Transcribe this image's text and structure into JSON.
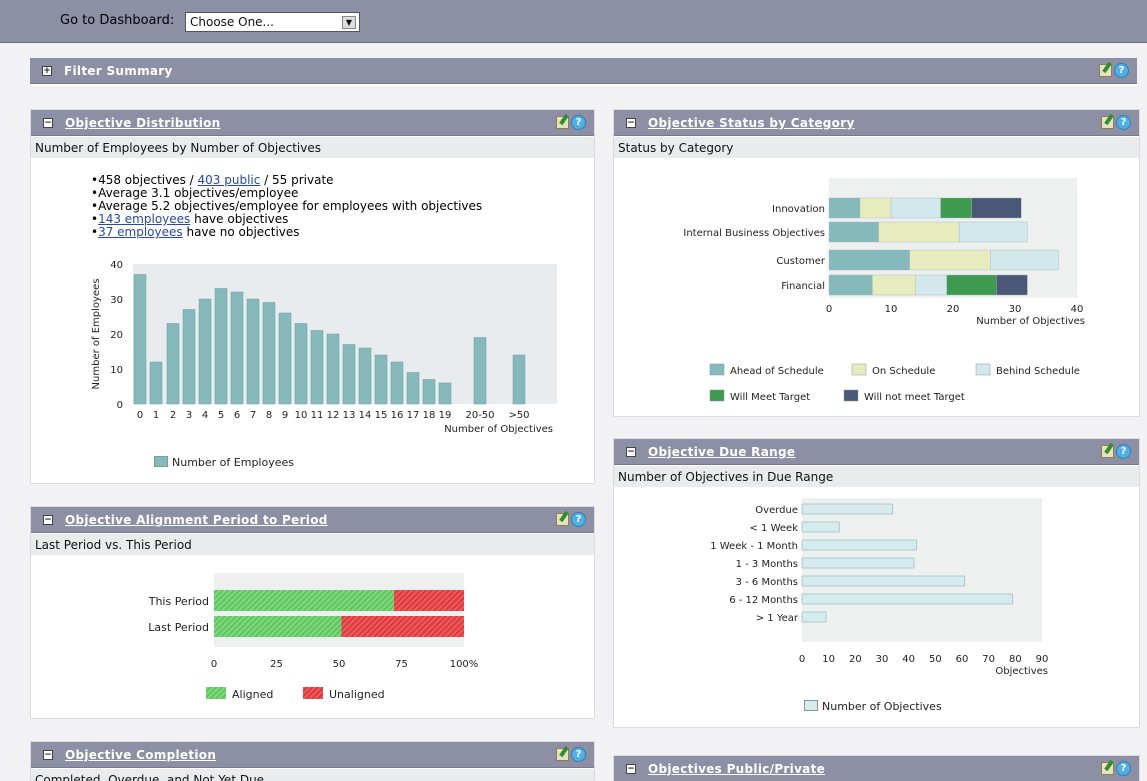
{
  "topbar": {
    "label": "Go to Dashboard:",
    "select_value": "Choose One..."
  },
  "filter": {
    "title": "Filter Summary",
    "toggle": "+"
  },
  "distribution": {
    "title": "Objective Distribution",
    "subtitle": "Number of Employees by Number of Objectives",
    "b1_pre": "•458 objectives / ",
    "b1_link": "403 public",
    "b1_post": " / 55 private",
    "b2": "•Average 3.1 objectives/employee",
    "b3": "•Average 5.2 objectives/employee for employees with objectives",
    "b4_link": "143 employees",
    "b4_post": " have objectives",
    "b5_link": "37 employees",
    "b5_post": " have no objectives",
    "legend": "Number of Employees"
  },
  "status": {
    "title": "Objective Status by Category",
    "subtitle": "Status by Category"
  },
  "due": {
    "title": "Objective Due Range",
    "subtitle": "Number of Objectives in Due Range",
    "legend": "Number of Objectives"
  },
  "alignment": {
    "title": "Objective Alignment Period to Period",
    "subtitle": "Last Period vs. This Period"
  },
  "completion": {
    "title": "Objective Completion",
    "subtitle": "Completed, Overdue, and Not Yet Due"
  },
  "public_private": {
    "title": "Objectives Public/Private"
  },
  "colors": {
    "aligned": "#5cc65c",
    "unaligned": "#e0393b",
    "teal": "#86b9bb"
  },
  "chart_data": [
    {
      "type": "bar",
      "title": "",
      "xlabel": "Number of Objectives",
      "ylabel": "Number of Employees",
      "ylim": [
        0,
        40
      ],
      "yticks": [
        0,
        10,
        20,
        30,
        40
      ],
      "categories": [
        "0",
        "1",
        "2",
        "3",
        "4",
        "5",
        "6",
        "7",
        "8",
        "9",
        "10",
        "11",
        "12",
        "13",
        "14",
        "15",
        "16",
        "17",
        "18",
        "19",
        "20-50",
        ">50"
      ],
      "series": [
        {
          "name": "Number of Employees",
          "values": [
            37,
            12,
            23,
            27,
            30,
            33,
            32,
            30,
            29,
            26,
            23,
            21,
            20,
            17,
            16,
            14,
            12,
            9,
            7,
            6,
            19,
            14
          ]
        }
      ]
    },
    {
      "type": "bar",
      "orientation": "horizontal",
      "stacked": true,
      "xlabel": "Number of Objectives",
      "xlim": [
        0,
        40
      ],
      "xticks": [
        0,
        10,
        20,
        30,
        40
      ],
      "categories": [
        "Innovation",
        "Internal Business Objectives",
        "Customer",
        "Financial"
      ],
      "series": [
        {
          "name": "Ahead of Schedule",
          "color": "#86b9bb",
          "values": [
            5,
            8,
            13,
            7
          ]
        },
        {
          "name": "On Schedule",
          "color": "#e7ecbe",
          "values": [
            5,
            13,
            13,
            7
          ]
        },
        {
          "name": "Behind Schedule",
          "color": "#d3e8ec",
          "values": [
            8,
            11,
            11,
            5
          ]
        },
        {
          "name": "Will Meet Target",
          "color": "#3e9a4e",
          "values": [
            5,
            0,
            0,
            8
          ]
        },
        {
          "name": "Will not meet Target",
          "color": "#4a5877",
          "values": [
            8,
            0,
            0,
            5
          ]
        }
      ]
    },
    {
      "type": "bar",
      "orientation": "horizontal",
      "xlabel": "Objectives",
      "xlim": [
        0,
        90
      ],
      "xticks": [
        0,
        10,
        20,
        30,
        40,
        50,
        60,
        70,
        80,
        90
      ],
      "categories": [
        "Overdue",
        "< 1 Week",
        "1 Week - 1 Month",
        "1 - 3 Months",
        "3 - 6 Months",
        "6 - 12 Months",
        "> 1 Year"
      ],
      "series": [
        {
          "name": "Number of Objectives",
          "values": [
            34,
            14,
            43,
            42,
            61,
            79,
            9
          ]
        }
      ]
    },
    {
      "type": "bar",
      "orientation": "horizontal",
      "stacked": true,
      "xlim": [
        0,
        100
      ],
      "xtick_labels": [
        "0",
        "25",
        "50",
        "75",
        "100%"
      ],
      "categories": [
        "This Period",
        "Last Period"
      ],
      "series": [
        {
          "name": "Aligned",
          "values": [
            72,
            51
          ]
        },
        {
          "name": "Unaligned",
          "values": [
            28,
            49
          ]
        }
      ]
    }
  ]
}
